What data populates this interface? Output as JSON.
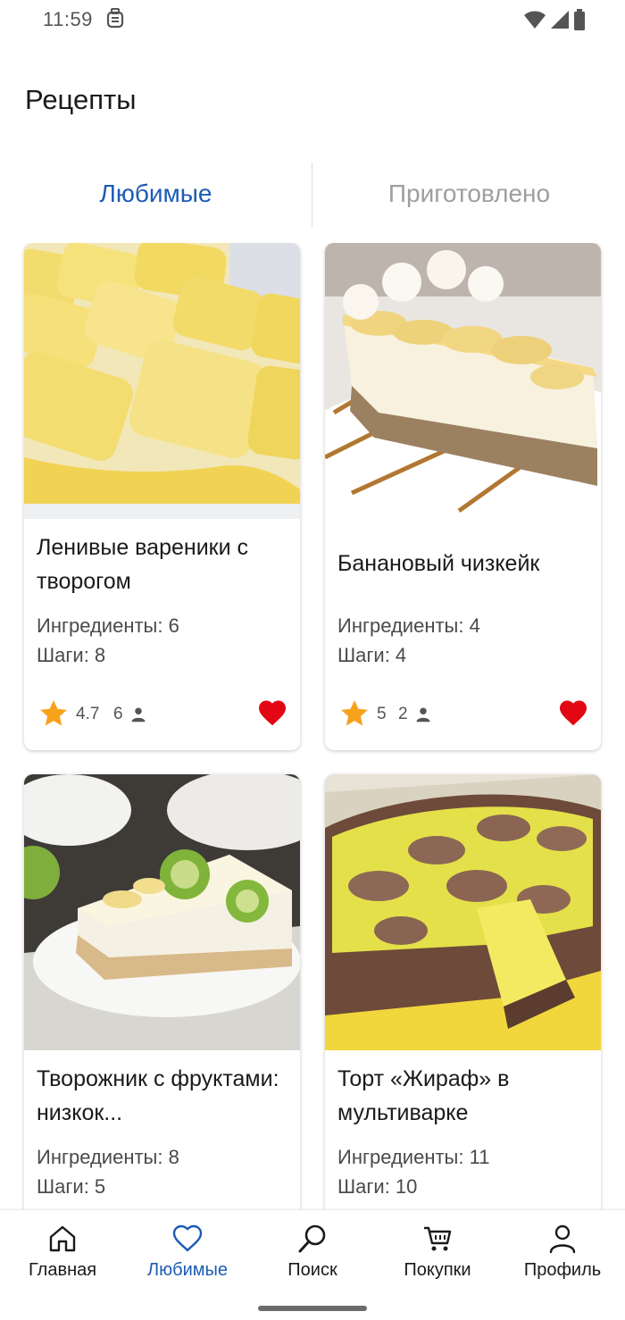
{
  "status_bar": {
    "time": "11:59",
    "icons": [
      "notification-icon",
      "wifi-icon",
      "signal-icon",
      "battery-icon"
    ]
  },
  "header": {
    "title": "Рецепты"
  },
  "tabs": [
    {
      "label": "Любимые",
      "active": true
    },
    {
      "label": "Приготовлено",
      "active": false
    }
  ],
  "colors": {
    "accent": "#1c5bb5",
    "heart": "#e30613",
    "star": "#f7a21b",
    "inactive": "#9e9e9e"
  },
  "cards": [
    {
      "title": "Ленивые вареники с творогом",
      "ingredients": "Ингредиенты: 6",
      "steps": "Шаги: 8",
      "rating": "4.7",
      "people": "6",
      "favorite": true
    },
    {
      "title": "Банановый чизкейк",
      "ingredients": "Ингредиенты: 4",
      "steps": "Шаги: 4",
      "rating": "5",
      "people": "2",
      "favorite": true
    },
    {
      "title": "Творожник с фруктами: низкок...",
      "ingredients": "Ингредиенты: 8",
      "steps": "Шаги: 5",
      "rating": "",
      "people": "",
      "favorite": true
    },
    {
      "title": "Торт «Жираф» в мультиварке",
      "ingredients": "Ингредиенты: 11",
      "steps": "Шаги: 10",
      "rating": "",
      "people": "",
      "favorite": true
    }
  ],
  "bottom_nav": [
    {
      "label": "Главная",
      "icon": "home-icon",
      "active": false
    },
    {
      "label": "Любимые",
      "icon": "heart-outline-icon",
      "active": true
    },
    {
      "label": "Поиск",
      "icon": "search-icon",
      "active": false
    },
    {
      "label": "Покупки",
      "icon": "cart-icon",
      "active": false
    },
    {
      "label": "Профиль",
      "icon": "profile-icon",
      "active": false
    }
  ]
}
